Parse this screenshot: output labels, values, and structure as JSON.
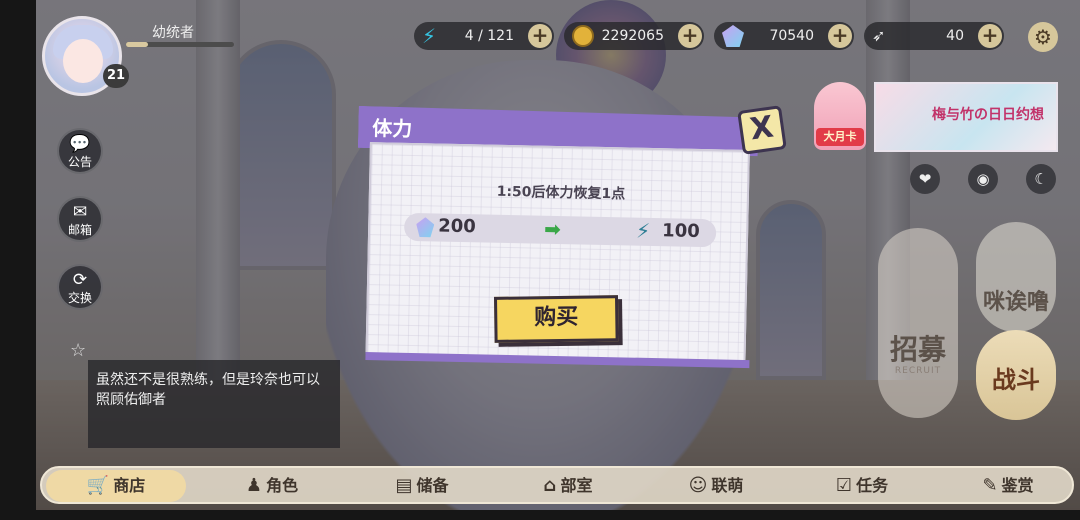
{
  "player": {
    "name": "幼统者",
    "level": "21",
    "exp_fraction": 0.2
  },
  "resources": [
    {
      "name": "stamina",
      "icon": "lightning-icon",
      "value": "4 / 121"
    },
    {
      "name": "coin",
      "icon": "coin-icon",
      "value": "2292065"
    },
    {
      "name": "gem",
      "icon": "gem-icon",
      "value": "70540"
    },
    {
      "name": "wing",
      "icon": "wing-icon",
      "value": "40"
    }
  ],
  "side_buttons": [
    {
      "label": "公告",
      "icon": "chat-bubble-icon"
    },
    {
      "label": "邮箱",
      "icon": "mail-icon"
    },
    {
      "label": "交换",
      "icon": "swap-icon"
    }
  ],
  "dialog_text": "虽然还不是很熟练，但是玲奈也可以照顾佑御者",
  "event": {
    "fox_label": "大月卡",
    "banner_text": "梅与竹の日日约想"
  },
  "right_buttons": {
    "recruit": "招募",
    "recruit_sub": "RECRUIT",
    "mimilu": "咪诶噜",
    "battle": "战斗"
  },
  "nav": [
    {
      "label": "商店",
      "icon": "shop-icon",
      "active": true
    },
    {
      "label": "角色",
      "icon": "character-icon",
      "active": false
    },
    {
      "label": "储备",
      "icon": "storage-icon",
      "active": false
    },
    {
      "label": "部室",
      "icon": "room-icon",
      "active": false
    },
    {
      "label": "联萌",
      "icon": "guild-icon",
      "active": false
    },
    {
      "label": "任务",
      "icon": "task-icon",
      "active": false
    },
    {
      "label": "鉴赏",
      "icon": "gallery-icon",
      "active": false
    }
  ],
  "modal": {
    "title": "体力",
    "recover_text": "1:50后体力恢复1点",
    "cost": "200",
    "gain": "100",
    "buy_label": "购买",
    "close_label": "X"
  },
  "colors": {
    "modal_accent": "#8e72c9",
    "buy_button": "#f6d660",
    "nav_bg": "#ded6c6"
  }
}
